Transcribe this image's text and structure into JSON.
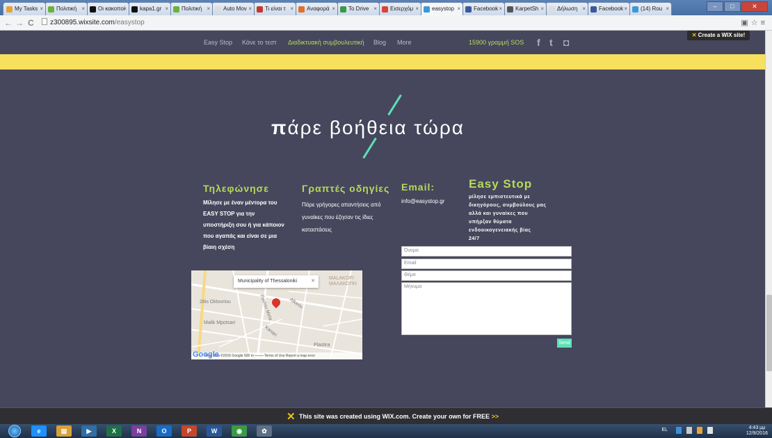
{
  "browser": {
    "tabs": [
      {
        "label": "My Tasks",
        "color": "#e5a13a"
      },
      {
        "label": "Πολιτική",
        "color": "#6bb13b"
      },
      {
        "label": "Οι κακοποί",
        "color": "#111111"
      },
      {
        "label": "kapa1.gr",
        "color": "#111111"
      },
      {
        "label": "Πολιτική",
        "color": "#6bb13b"
      },
      {
        "label": "Auto Mov",
        "color": "#dddddd"
      },
      {
        "label": "Τι είναι τ",
        "color": "#c0392b"
      },
      {
        "label": "Αναφορά",
        "color": "#e0702a"
      },
      {
        "label": "To Drive",
        "color": "#3a9a48"
      },
      {
        "label": "Εισερχόμ",
        "color": "#d44638"
      },
      {
        "label": "easystop",
        "color": "#3b99d9",
        "active": true
      },
      {
        "label": "Facebook",
        "color": "#3b5998"
      },
      {
        "label": "KarpetSh",
        "color": "#555555"
      },
      {
        "label": "Δήλωση",
        "color": "#dddddd"
      },
      {
        "label": "Facebook",
        "color": "#3b5998"
      },
      {
        "label": "(14) Rou",
        "color": "#3b99d9"
      }
    ],
    "url_host": "z300895.wixsite.com",
    "url_path": "/easystop"
  },
  "nav": {
    "items": [
      "Easy Stop",
      "Κάνε το τεστ",
      "Διαδικτυακή συμβουλευτική",
      "Blog",
      "More"
    ],
    "sos": "15900 γραμμή SOS",
    "social": [
      "f",
      "t",
      "◘"
    ],
    "wix_badge": "Create a WIX site!"
  },
  "hero": {
    "title_bold": "π",
    "title_rest": "άρε βοήθεια τώρα"
  },
  "columns": [
    {
      "title": "Τηλεφώνησε",
      "text": "Μίλησε με έναν μέντορα του EASY STOP για την υποστήριξη σου ή για κάποιον που αγαπάς και είναι σε μια βίαιη σχέση"
    },
    {
      "title": "Γραπτές οδηγίες",
      "text": "Πάρε γρήγορες απαντήσεις από γυναίκες που έζησαν τις ίδιες καταστάσεις"
    },
    {
      "title": "Email:",
      "text": "info@easystop.gr"
    }
  ],
  "easystop": {
    "title": "Easy Stop",
    "text": "μίλησε εμπιστευτικά με δικηγόρους, συμβούλους μας αλλά και γυναίκες που υπήρξαν θύματα ενδοοικογενειακής βίας",
    "hours": "24/7"
  },
  "form": {
    "name_placeholder": "Όνομα",
    "email_placeholder": "Email",
    "subject_placeholder": "Θέμα",
    "message_placeholder": "Μήνυμα",
    "send_label": "Send"
  },
  "map": {
    "popup": "Municipality of Thessaloniki",
    "district": "ΜΑΛΑΚΟΠΗ",
    "district2": "MALAKOPI",
    "streets": [
      "28is Oktovriou",
      "Malik Mpotsari",
      "Pavlou Mela",
      "Kanari",
      "Alkeou",
      "Plastira"
    ],
    "footer": "Map data ©2016 Google   500 m ⎯⎯⎯⎯⎯   Terms of Use   Report a map error",
    "logo": "Google"
  },
  "wix_footer": {
    "text": "This site was created using WIX.com. Create your own for FREE",
    "arrows": ">>"
  },
  "taskbar": {
    "apps": [
      {
        "label": "e",
        "color": "#1e90ff"
      },
      {
        "label": "▤",
        "color": "#d8a13a"
      },
      {
        "label": "▶",
        "color": "#2f6ea5"
      },
      {
        "label": "X",
        "color": "#1e7145"
      },
      {
        "label": "N",
        "color": "#7b3f9d"
      },
      {
        "label": "O",
        "color": "#1a6bc4"
      },
      {
        "label": "P",
        "color": "#c4472b"
      },
      {
        "label": "W",
        "color": "#2b5797"
      },
      {
        "label": "◉",
        "color": "#3c9a44"
      },
      {
        "label": "✿",
        "color": "#5f6f85"
      }
    ],
    "lang": "EL",
    "time": "4:43 μμ",
    "date": "12/9/2016"
  }
}
